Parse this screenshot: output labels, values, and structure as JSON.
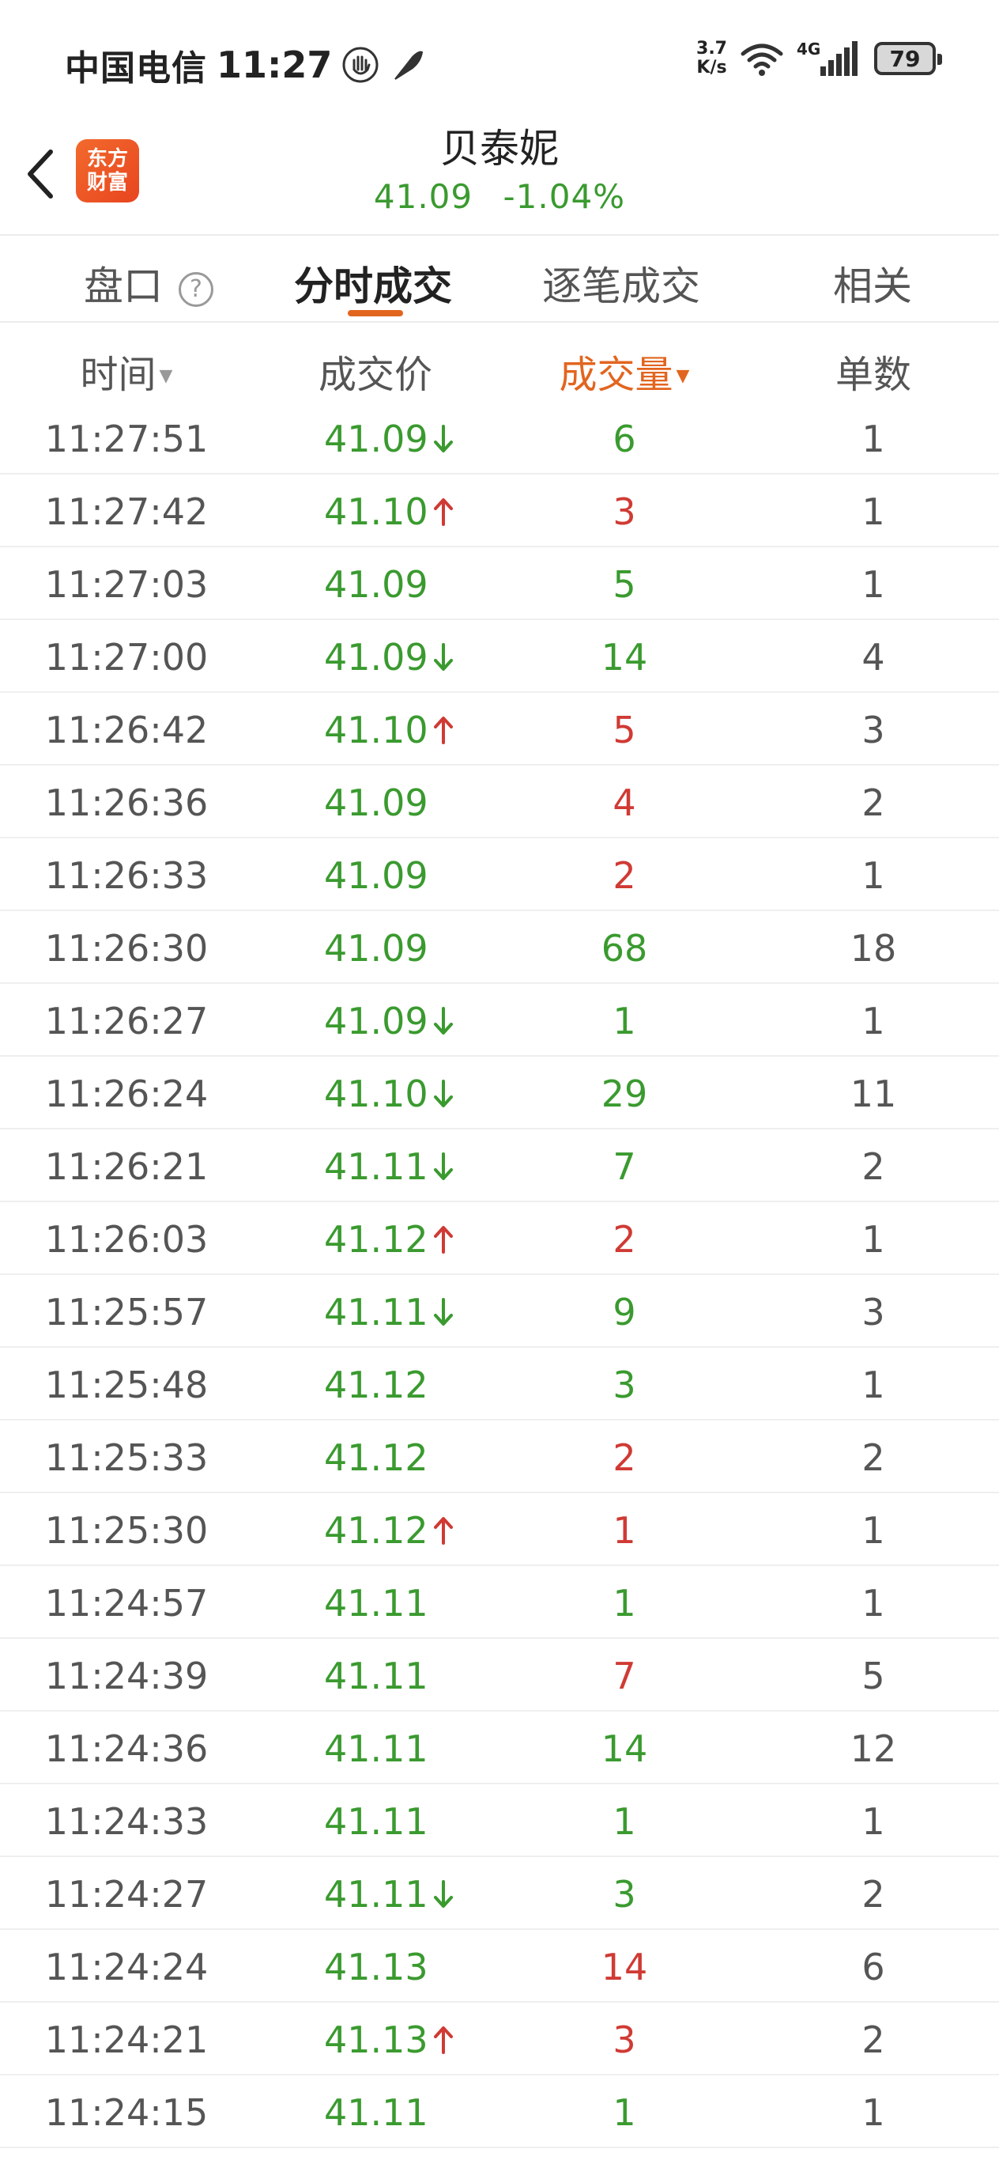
{
  "status_bar": {
    "carrier": "中国电信",
    "time": "11:27",
    "net_speed_top": "3.7",
    "net_speed_bottom": "K/s",
    "signal_label": "4G",
    "battery": "79"
  },
  "header": {
    "logo_line1": "东方",
    "logo_line2": "财富",
    "stock_name": "贝泰妮",
    "price": "41.09",
    "change": "-1.04%"
  },
  "tabs": [
    {
      "label": "盘口",
      "active": false
    },
    {
      "label": "分时成交",
      "active": true
    },
    {
      "label": "逐笔成交",
      "active": false
    },
    {
      "label": "相关",
      "active": false
    }
  ],
  "help_glyph": "?",
  "columns": {
    "time": "时间",
    "price": "成交价",
    "volume": "成交量",
    "count": "单数"
  },
  "colors": {
    "up": "#d03a34",
    "down": "#3a9a2f",
    "accent": "#e2651f"
  },
  "rows": [
    {
      "time": "11:27:51",
      "price": "41.09",
      "arrow": "down",
      "volume": "6",
      "vol_color": "green",
      "count": "1"
    },
    {
      "time": "11:27:42",
      "price": "41.10",
      "arrow": "up",
      "volume": "3",
      "vol_color": "red",
      "count": "1"
    },
    {
      "time": "11:27:03",
      "price": "41.09",
      "arrow": "",
      "volume": "5",
      "vol_color": "green",
      "count": "1"
    },
    {
      "time": "11:27:00",
      "price": "41.09",
      "arrow": "down",
      "volume": "14",
      "vol_color": "green",
      "count": "4"
    },
    {
      "time": "11:26:42",
      "price": "41.10",
      "arrow": "up",
      "volume": "5",
      "vol_color": "red",
      "count": "3"
    },
    {
      "time": "11:26:36",
      "price": "41.09",
      "arrow": "",
      "volume": "4",
      "vol_color": "red",
      "count": "2"
    },
    {
      "time": "11:26:33",
      "price": "41.09",
      "arrow": "",
      "volume": "2",
      "vol_color": "red",
      "count": "1"
    },
    {
      "time": "11:26:30",
      "price": "41.09",
      "arrow": "",
      "volume": "68",
      "vol_color": "green",
      "count": "18"
    },
    {
      "time": "11:26:27",
      "price": "41.09",
      "arrow": "down",
      "volume": "1",
      "vol_color": "green",
      "count": "1"
    },
    {
      "time": "11:26:24",
      "price": "41.10",
      "arrow": "down",
      "volume": "29",
      "vol_color": "green",
      "count": "11"
    },
    {
      "time": "11:26:21",
      "price": "41.11",
      "arrow": "down",
      "volume": "7",
      "vol_color": "green",
      "count": "2"
    },
    {
      "time": "11:26:03",
      "price": "41.12",
      "arrow": "up",
      "volume": "2",
      "vol_color": "red",
      "count": "1"
    },
    {
      "time": "11:25:57",
      "price": "41.11",
      "arrow": "down",
      "volume": "9",
      "vol_color": "green",
      "count": "3"
    },
    {
      "time": "11:25:48",
      "price": "41.12",
      "arrow": "",
      "volume": "3",
      "vol_color": "green",
      "count": "1"
    },
    {
      "time": "11:25:33",
      "price": "41.12",
      "arrow": "",
      "volume": "2",
      "vol_color": "red",
      "count": "2"
    },
    {
      "time": "11:25:30",
      "price": "41.12",
      "arrow": "up",
      "volume": "1",
      "vol_color": "red",
      "count": "1"
    },
    {
      "time": "11:24:57",
      "price": "41.11",
      "arrow": "",
      "volume": "1",
      "vol_color": "green",
      "count": "1"
    },
    {
      "time": "11:24:39",
      "price": "41.11",
      "arrow": "",
      "volume": "7",
      "vol_color": "red",
      "count": "5"
    },
    {
      "time": "11:24:36",
      "price": "41.11",
      "arrow": "",
      "volume": "14",
      "vol_color": "green",
      "count": "12"
    },
    {
      "time": "11:24:33",
      "price": "41.11",
      "arrow": "",
      "volume": "1",
      "vol_color": "green",
      "count": "1"
    },
    {
      "time": "11:24:27",
      "price": "41.11",
      "arrow": "down",
      "volume": "3",
      "vol_color": "green",
      "count": "2"
    },
    {
      "time": "11:24:24",
      "price": "41.13",
      "arrow": "",
      "volume": "14",
      "vol_color": "red",
      "count": "6"
    },
    {
      "time": "11:24:21",
      "price": "41.13",
      "arrow": "up",
      "volume": "3",
      "vol_color": "red",
      "count": "2"
    },
    {
      "time": "11:24:15",
      "price": "41.11",
      "arrow": "",
      "volume": "1",
      "vol_color": "green",
      "count": "1"
    }
  ]
}
